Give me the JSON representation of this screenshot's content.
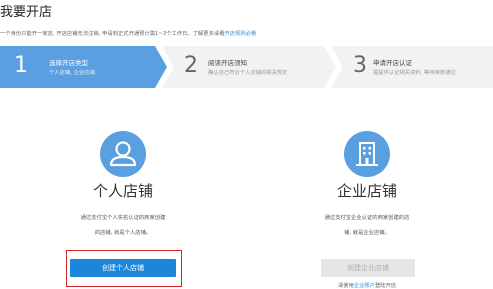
{
  "page": {
    "title": "我要开店"
  },
  "intro": {
    "text": "一个身份只能开一家店, 开店店铺无法注销, 申请到正式开通预计需1~3个工作日。了解更多请看",
    "link": "开店规则必看"
  },
  "steps": [
    {
      "number": "1",
      "title": "选择开店类型",
      "desc": "个人店铺, 企业店铺",
      "active": true
    },
    {
      "number": "2",
      "title": "阅读开店须知",
      "desc": "确认自己符合个人店铺的相关规定",
      "active": false
    },
    {
      "number": "3",
      "title": "申请开店认证",
      "desc": "需提供认证相关资料, 等待审核通过",
      "active": false
    }
  ],
  "personal": {
    "icon": "user-icon",
    "title": "个人店铺",
    "desc_line1": "通过支付宝个人实名认证的商家创建",
    "desc_line2": "的店铺, 就是个人店铺。",
    "button": "创建个人店铺"
  },
  "enterprise": {
    "icon": "building-icon",
    "title": "企业店铺",
    "desc_line1": "通过支付宝企业认证的商家创建的店",
    "desc_line2": "铺, 就是企业店铺。",
    "button": "创建企业店铺",
    "note_prefix": "请使用",
    "note_link": "企业账户",
    "note_suffix": "登陆开店"
  },
  "colors": {
    "accent": "#5a9fe0",
    "primary_button": "#1e86d8",
    "highlight_border": "#d9272e",
    "link": "#2d8fe0"
  }
}
